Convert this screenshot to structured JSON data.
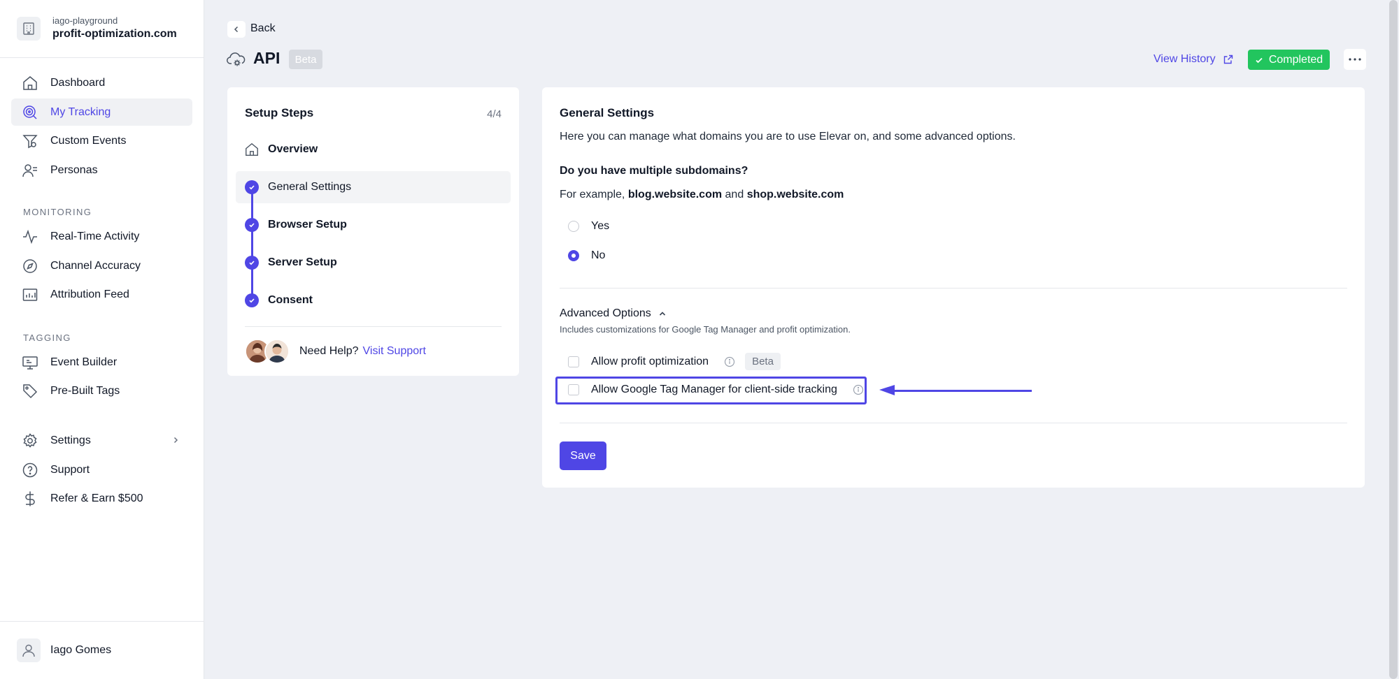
{
  "sidebar": {
    "workspace": {
      "org": "iago-playground",
      "domain": "profit-optimization.com"
    },
    "main_items": [
      {
        "label": "Dashboard",
        "icon": "home-icon"
      },
      {
        "label": "My Tracking",
        "icon": "tracking-icon",
        "active": true
      },
      {
        "label": "Custom Events",
        "icon": "custom-events-icon"
      },
      {
        "label": "Personas",
        "icon": "personas-icon"
      }
    ],
    "monitoring_label": "MONITORING",
    "monitoring_items": [
      {
        "label": "Real-Time Activity",
        "icon": "activity-icon"
      },
      {
        "label": "Channel Accuracy",
        "icon": "compass-icon"
      },
      {
        "label": "Attribution Feed",
        "icon": "chart-icon"
      }
    ],
    "tagging_label": "TAGGING",
    "tagging_items": [
      {
        "label": "Event Builder",
        "icon": "monitor-icon"
      },
      {
        "label": "Pre-Built Tags",
        "icon": "tag-icon"
      }
    ],
    "bottom_items": [
      {
        "label": "Settings",
        "icon": "gear-icon"
      },
      {
        "label": "Support",
        "icon": "help-circle-icon"
      },
      {
        "label": "Refer & Earn $500",
        "icon": "dollar-icon"
      }
    ],
    "user_name": "Iago Gomes"
  },
  "header": {
    "back_label": "Back",
    "title": "API",
    "title_badge": "Beta",
    "view_history": "View History",
    "status": "Completed",
    "status_color": "#22c55e"
  },
  "setup_steps": {
    "title": "Setup Steps",
    "count": "4/4",
    "steps": [
      {
        "label": "Overview",
        "state": "overview"
      },
      {
        "label": "General Settings",
        "state": "complete",
        "active": true
      },
      {
        "label": "Browser Setup",
        "state": "complete"
      },
      {
        "label": "Server Setup",
        "state": "complete"
      },
      {
        "label": "Consent",
        "state": "complete"
      }
    ],
    "help_text": "Need Help?",
    "help_link": "Visit Support"
  },
  "general_settings": {
    "title": "General Settings",
    "description": "Here you can manage what domains you are to use Elevar on, and some advanced options.",
    "question": "Do you have multiple subdomains?",
    "example_prefix": "For example,",
    "example_domain_1": "blog.website.com",
    "example_and": "and",
    "example_domain_2": "shop.website.com",
    "options": [
      {
        "label": "Yes",
        "selected": false
      },
      {
        "label": "No",
        "selected": true
      }
    ],
    "advanced_title": "Advanced Options",
    "advanced_description": "Includes customizations for Google Tag Manager and profit optimization.",
    "advanced_options": [
      {
        "label": "Allow profit optimization",
        "checked": false,
        "badge": "Beta"
      },
      {
        "label": "Allow Google Tag Manager for client-side tracking",
        "checked": false
      }
    ],
    "save_label": "Save",
    "accent_color": "#4f46e5"
  }
}
